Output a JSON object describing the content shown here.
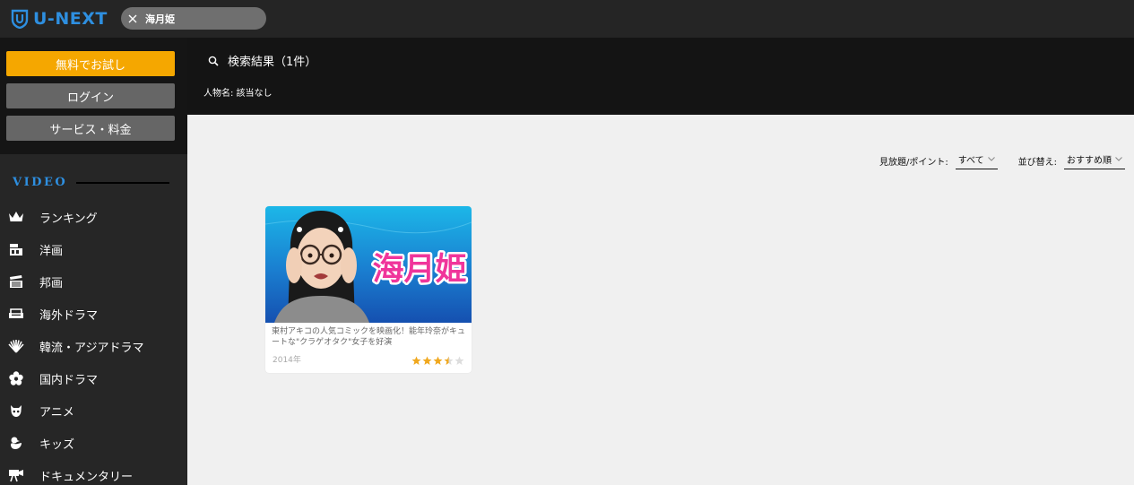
{
  "app": {
    "logo_text": "U-NEXT",
    "brand_color": "#2e8fe0"
  },
  "search": {
    "query": "海月姫"
  },
  "sidebar": {
    "buttons": {
      "trial": "無料でお試し",
      "login": "ログイン",
      "service": "サービス・料金"
    },
    "section_heading": "VIDEO",
    "items": [
      {
        "label": "ランキング",
        "icon": "crown-icon"
      },
      {
        "label": "洋画",
        "icon": "film-clapper-icon"
      },
      {
        "label": "邦画",
        "icon": "clapperboard-icon"
      },
      {
        "label": "海外ドラマ",
        "icon": "sofa-icon"
      },
      {
        "label": "韓流・アジアドラマ",
        "icon": "fan-icon"
      },
      {
        "label": "国内ドラマ",
        "icon": "flower-icon"
      },
      {
        "label": "アニメ",
        "icon": "mascot-icon"
      },
      {
        "label": "キッズ",
        "icon": "duck-icon"
      },
      {
        "label": "ドキュメンタリー",
        "icon": "camera-icon"
      }
    ]
  },
  "results": {
    "title": "検索結果（1件）",
    "person_line": "人物名: 該当なし"
  },
  "filters": {
    "availability_label": "見放題/ポイント:",
    "availability_value": "すべて",
    "sort_label": "並び替え:",
    "sort_value": "おすすめ順"
  },
  "cards": [
    {
      "title_art": "海月姫",
      "description": "東村アキコの人気コミックを映画化！能年玲奈がキュートな\"クラゲオタク\"女子を好演",
      "year": "2014年",
      "rating": 3.5,
      "rating_max": 5
    }
  ],
  "colors": {
    "accent": "#f5a700",
    "star": "#f0a81e",
    "star_empty": "#dddddd"
  }
}
